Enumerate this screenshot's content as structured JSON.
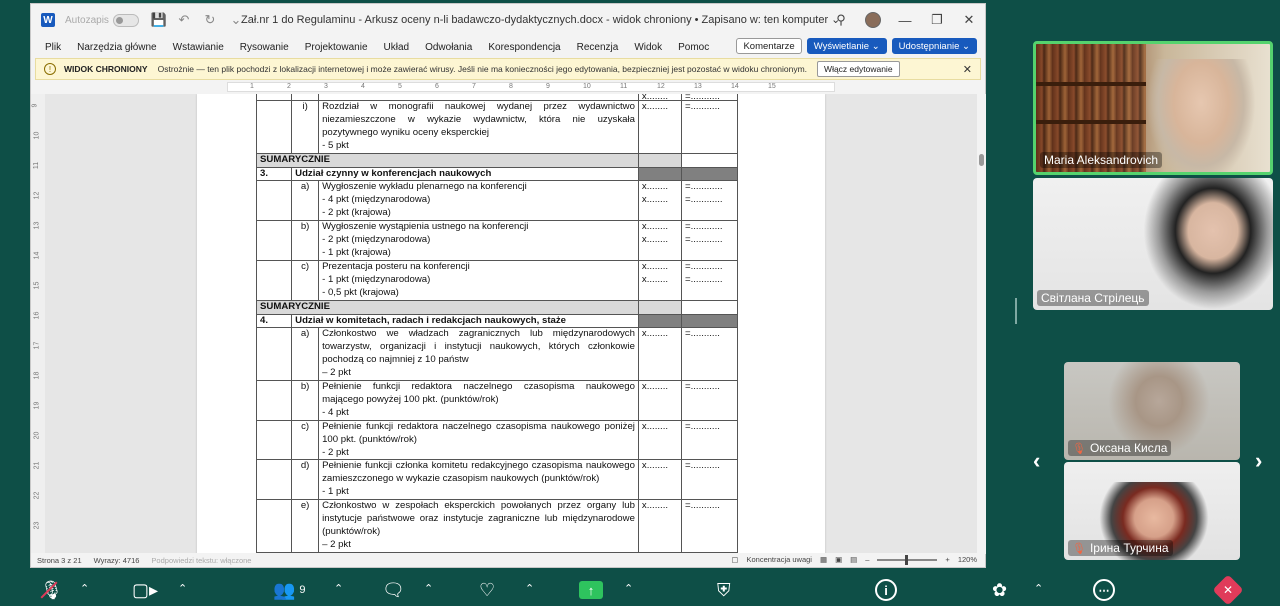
{
  "word": {
    "autosave_label": "Autozapis",
    "doc_title": "Zał.nr 1 do Regulaminu - Arkusz oceny n-li badawczo-dydaktycznych.docx  -  widok chroniony • Zapisano w: ten komputer ⌄",
    "menu": [
      "Plik",
      "Narzędzia główne",
      "Wstawianie",
      "Rysowanie",
      "Projektowanie",
      "Układ",
      "Odwołania",
      "Korespondencja",
      "Recenzja",
      "Widok",
      "Pomoc"
    ],
    "comments_btn": "Komentarze",
    "view_btn": "Wyświetlanie ⌄",
    "share_btn": "Udostępnianie ⌄",
    "protected": {
      "title": "WIDOK CHRONIONY",
      "text": "Ostrożnie — ten plik pochodzi z lokalizacji internetowej i może zawierać wirusy. Jeśli nie ma konieczności jego edytowania, bezpieczniej jest pozostać w widoku chronionym.",
      "enable_btn": "Włącz edytowanie"
    },
    "ruler_ticks": [
      "1",
      "2",
      "3",
      "4",
      "5",
      "6",
      "7",
      "8",
      "9",
      "10",
      "11",
      "12",
      "13",
      "14",
      "15"
    ],
    "vruler_ticks": [
      "9",
      "10",
      "11",
      "12",
      "13",
      "14",
      "15",
      "16",
      "17",
      "18",
      "19",
      "20",
      "21",
      "22",
      "23",
      "4"
    ],
    "table": {
      "r0": {
        "c4": "x........",
        "c5": "=..........."
      },
      "r_i": {
        "label": "i)",
        "text": "Rozdział w monografii naukowej wydanej przez wydawnictwo niezamieszczone w wykazie wydawnictw, która nie uzyskała pozytywnego wyniku oceny eksperckiej",
        "pts": "- 5 pkt",
        "x": "x........",
        "eq": "=..........."
      },
      "sum1": "SUMARYCZNIE",
      "s3": {
        "num": "3.",
        "title": "Udział czynny w konferencjach naukowych"
      },
      "s3a": {
        "label": "a)",
        "text": "Wygłoszenie wykładu plenarnego na konferencji",
        "l1": "- 4 pkt (międzynarodowa)",
        "l2": "- 2 pkt (krajowa)",
        "x1": "x........",
        "x2": "x........",
        "e1": "=............",
        "e2": "=............"
      },
      "s3b": {
        "label": "b)",
        "text": "Wygłoszenie wystąpienia ustnego na konferencji",
        "l1": "- 2 pkt (międzynarodowa)",
        "l2": "- 1 pkt (krajowa)",
        "x1": "x........",
        "x2": "x........",
        "e1": "=............",
        "e2": "=............"
      },
      "s3c": {
        "label": "c)",
        "text": "Prezentacja posteru na konferencji",
        "l1": "- 1 pkt (międzynarodowa)",
        "l2": "- 0,5 pkt (krajowa)",
        "x1": "x........",
        "x2": "x........",
        "e1": "=............",
        "e2": "=............"
      },
      "sum2": "SUMARYCZNIE",
      "s4": {
        "num": "4.",
        "title": "Udział w komitetach, radach i redakcjach naukowych, staże"
      },
      "s4a": {
        "label": "a)",
        "text": "Członkostwo we władzach zagranicznych lub międzynarodowych towarzystw, organizacji i instytucji naukowych, których członkowie pochodzą co najmniej z 10 państw",
        "pts": "– 2 pkt",
        "x": "x........",
        "eq": "=..........."
      },
      "s4b": {
        "label": "b)",
        "text": "Pełnienie funkcji redaktora naczelnego czasopisma naukowego mającego powyżej 100 pkt. (punktów/rok)",
        "pts": "- 4 pkt",
        "x": "x........",
        "eq": "=..........."
      },
      "s4c": {
        "label": "c)",
        "text": "Pełnienie funkcji redaktora naczelnego czasopisma naukowego poniżej 100 pkt. (punktów/rok)",
        "pts": "- 2 pkt",
        "x": "x........",
        "eq": "=..........."
      },
      "s4d": {
        "label": "d)",
        "text": "Pełnienie funkcji członka komitetu redakcyjnego czasopisma naukowego zamieszczonego w wykazie czasopism naukowych (punktów/rok)",
        "pts": "- 1 pkt",
        "x": "x........",
        "eq": "=..........."
      },
      "s4e": {
        "label": "e)",
        "text": "Członkostwo w zespołach eksperckich powołanych przez organy lub instytucje państwowe oraz instytucje zagraniczne lub międzynarodowe (punktów/rok)",
        "pts": "– 2 pkt",
        "x": "x........",
        "eq": "=..........."
      }
    },
    "status": {
      "page": "Strona 3 z 21",
      "words": "Wyrazy: 4716",
      "predict": "Podpowiedzi tekstu: włączone",
      "focus": "Koncentracja uwagi",
      "zoom": "120%"
    }
  },
  "participants": [
    {
      "name": "Maria Aleksandrovich",
      "muted": false,
      "speaking": true
    },
    {
      "name": "Світлана Стрілець",
      "muted": false,
      "speaking": false
    },
    {
      "name": "Оксана Кисла",
      "muted": true,
      "speaking": false
    },
    {
      "name": "Ірина Турчина",
      "muted": true,
      "speaking": false
    }
  ],
  "toolbar": {
    "participants_count": "9"
  },
  "colors": {
    "background": "#0e4f47",
    "speaking_border": "#55d36e",
    "word_blue": "#185abd",
    "share_green": "#2ec35e",
    "end_red": "#e03b5a"
  }
}
